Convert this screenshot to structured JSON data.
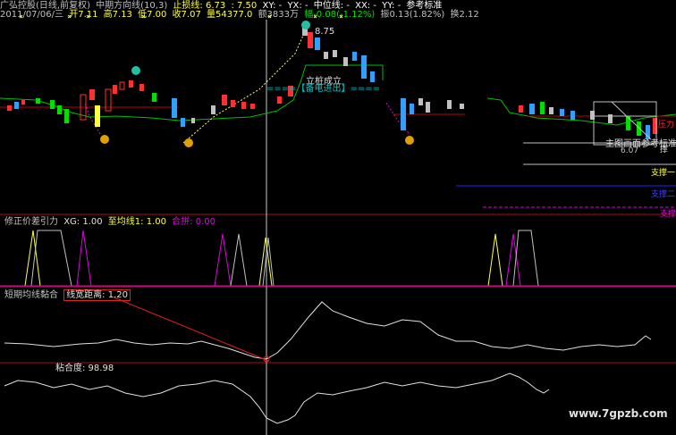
{
  "header": {
    "title": "广弘控股(日线,前复权)",
    "indicator": "中期方向线(10,3)",
    "stop_loss": "止损线: 6.73",
    "stop_val2": ": 7.50",
    "xy": "XY: -",
    "yx": "YX: -",
    "mid": "中位线: -",
    "xx": "XX: -",
    "yy": "YY: -",
    "ref": "参考标准"
  },
  "quote": {
    "date": "2011/07/06/三",
    "open": "开7.11",
    "high": "高7.13",
    "low": "低7.00",
    "close": "收7.07",
    "vol": "量54377.0",
    "amt": "额3833万",
    "chg": "幅-0.08(-1.12%)",
    "amp": "振0.13(1.82%)",
    "turn": "换2.12"
  },
  "chart_labels": {
    "high_price": "8.75",
    "lidong": "立桩成立",
    "bei": "====【备电进出】====",
    "main_std": "主图画面参考标准",
    "low_price": "6.07",
    "zhicheng1": "支撑一",
    "zhicheng2": "支撑二",
    "pressure": "压力",
    "support_short": "撑",
    "support_mid": "支撑"
  },
  "panel2": {
    "title": "修正价差引力",
    "xg": "XG: 1.00",
    "avg": "至均线1: 1.00",
    "hebing": "合拼: 0.00"
  },
  "panel3": {
    "title": "短期均线黏合",
    "width": "线宽距离: 1.20"
  },
  "panel4": {
    "label": "粘合度: 98.98"
  },
  "watermark": "www.7gpzb.com",
  "colors": {
    "up": "#ff3030",
    "down": "#30a0ff",
    "green_candle": "#00e000",
    "yellow": "#ffff40",
    "magenta": "#e000e0"
  }
}
